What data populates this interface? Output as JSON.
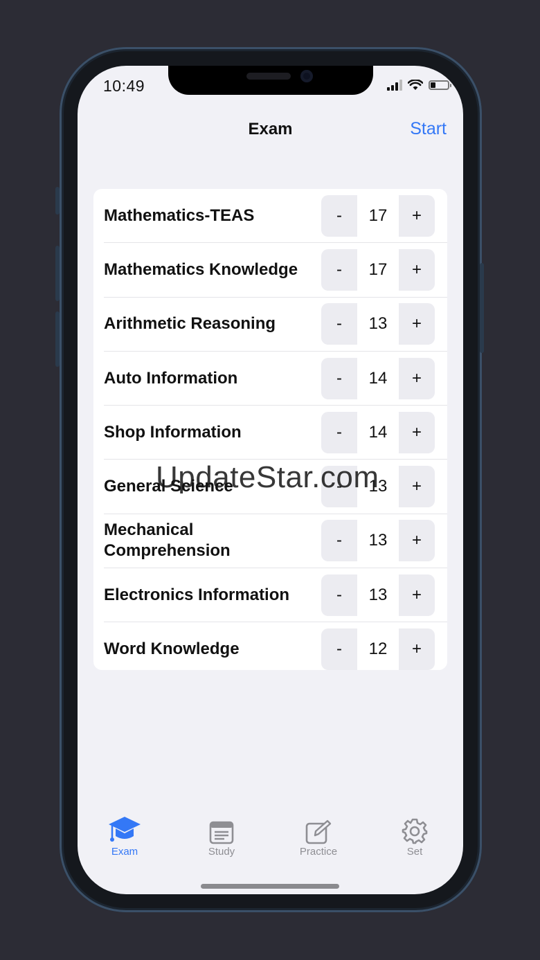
{
  "status_bar": {
    "time": "10:49"
  },
  "nav": {
    "title": "Exam",
    "start_label": "Start"
  },
  "subjects": [
    {
      "label": "Mathematics-TEAS",
      "value": "17"
    },
    {
      "label": "Mathematics Knowledge",
      "value": "17"
    },
    {
      "label": "Arithmetic Reasoning",
      "value": "13"
    },
    {
      "label": "Auto Information",
      "value": "14"
    },
    {
      "label": "Shop Information",
      "value": "14"
    },
    {
      "label": "General Science",
      "value": "13"
    },
    {
      "label": "Mechanical Comprehension",
      "value": "13"
    },
    {
      "label": "Electronics Information",
      "value": "13"
    },
    {
      "label": "Word Knowledge",
      "value": "12"
    }
  ],
  "stepper": {
    "minus": "-",
    "plus": "+"
  },
  "watermark": "UpdateStar.com",
  "tabs": [
    {
      "label": "Exam",
      "icon": "graduation-cap-icon",
      "active": true
    },
    {
      "label": "Study",
      "icon": "newspaper-icon",
      "active": false
    },
    {
      "label": "Practice",
      "icon": "square-pencil-icon",
      "active": false
    },
    {
      "label": "Set",
      "icon": "gear-icon",
      "active": false
    }
  ],
  "colors": {
    "accent": "#3478f6",
    "background": "#f1f1f6",
    "inactive_tab": "#8e8e93"
  }
}
